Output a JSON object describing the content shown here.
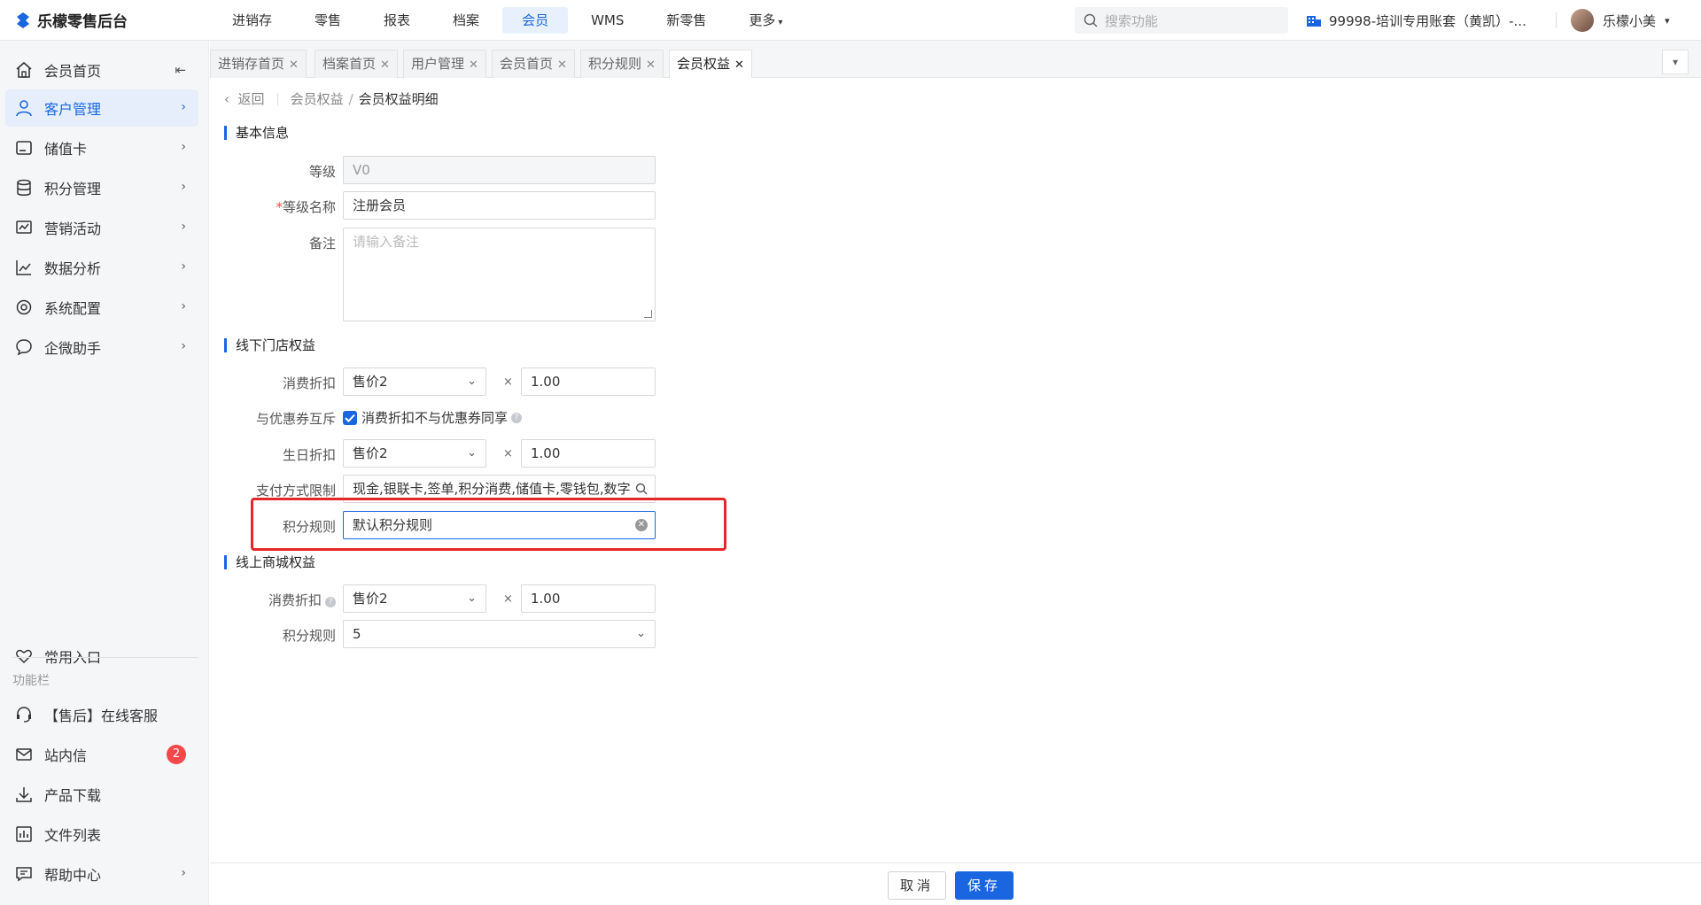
{
  "app": {
    "title": "乐檬零售后台"
  },
  "nav": {
    "items": [
      "进销存",
      "零售",
      "报表",
      "档案",
      "会员",
      "WMS",
      "新零售",
      "更多"
    ],
    "active": "会员"
  },
  "search": {
    "placeholder": "搜索功能"
  },
  "account": {
    "name": "99998-培训专用账套（黄凯）-..."
  },
  "user": {
    "name": "乐檬小美"
  },
  "sidebar": {
    "items": [
      {
        "label": "会员首页",
        "icon": "home-icon"
      },
      {
        "label": "客户管理",
        "icon": "user-icon"
      },
      {
        "label": "储值卡",
        "icon": "card-icon"
      },
      {
        "label": "积分管理",
        "icon": "database-icon"
      },
      {
        "label": "营销活动",
        "icon": "chart-icon"
      },
      {
        "label": "数据分析",
        "icon": "trend-icon"
      },
      {
        "label": "系统配置",
        "icon": "settings-icon"
      },
      {
        "label": "企微助手",
        "icon": "chat-icon"
      }
    ],
    "favorites": "常用入口",
    "section_label": "功能栏",
    "tools": [
      {
        "label": "【售后】在线客服",
        "icon": "headset-icon"
      },
      {
        "label": "站内信",
        "icon": "mail-icon",
        "badge": "2"
      },
      {
        "label": "产品下载",
        "icon": "download-icon"
      },
      {
        "label": "文件列表",
        "icon": "file-list-icon"
      },
      {
        "label": "帮助中心",
        "icon": "help-icon"
      }
    ]
  },
  "tabs": [
    {
      "label": "进销存首页"
    },
    {
      "label": "档案首页"
    },
    {
      "label": "用户管理"
    },
    {
      "label": "会员首页"
    },
    {
      "label": "积分规则"
    },
    {
      "label": "会员权益"
    }
  ],
  "breadcrumb": {
    "back": "返回",
    "parent": "会员权益",
    "current": "会员权益明细"
  },
  "basic": {
    "title": "基本信息",
    "level_label": "等级",
    "level_value": "V0",
    "name_label": "等级名称",
    "name_value": "注册会员",
    "remark_label": "备注",
    "remark_placeholder": "请输入备注"
  },
  "offline": {
    "title": "线下门店权益",
    "discount_label": "消费折扣",
    "discount_select": "售价2",
    "discount_value": "1.00",
    "coupon_label": "与优惠券互斥",
    "coupon_check_label": "消费折扣不与优惠券同享",
    "birthday_label": "生日折扣",
    "birthday_select": "售价2",
    "birthday_value": "1.00",
    "payment_label": "支付方式限制",
    "payment_value": "现金,银联卡,签单,积分消费,储值卡,零钱包,数字",
    "points_label": "积分规则",
    "points_value": "默认积分规则"
  },
  "online": {
    "title": "线上商城权益",
    "discount_label": "消费折扣",
    "discount_select": "售价2",
    "discount_value": "1.00",
    "points_label": "积分规则",
    "points_value": "5"
  },
  "times_symbol": "×",
  "footer": {
    "cancel": "取消",
    "save": "保存"
  },
  "colors": {
    "primary": "#1a66e0",
    "danger": "#e5262a",
    "badge": "#f5484a"
  }
}
